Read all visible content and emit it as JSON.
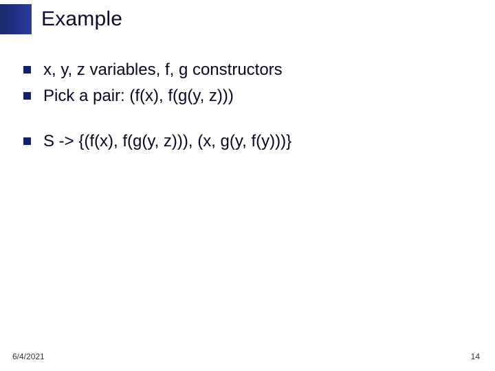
{
  "title": "Example",
  "bullets": {
    "b1": "x, y, z variables, f, g constructors",
    "b2": "Pick a pair: (f(x), f(g(y, z)))",
    "b3": "S -> {(f(x), f(g(y, z))), (x, g(y, f(y)))}"
  },
  "footer": {
    "date": "6/4/2021",
    "page": "14"
  }
}
